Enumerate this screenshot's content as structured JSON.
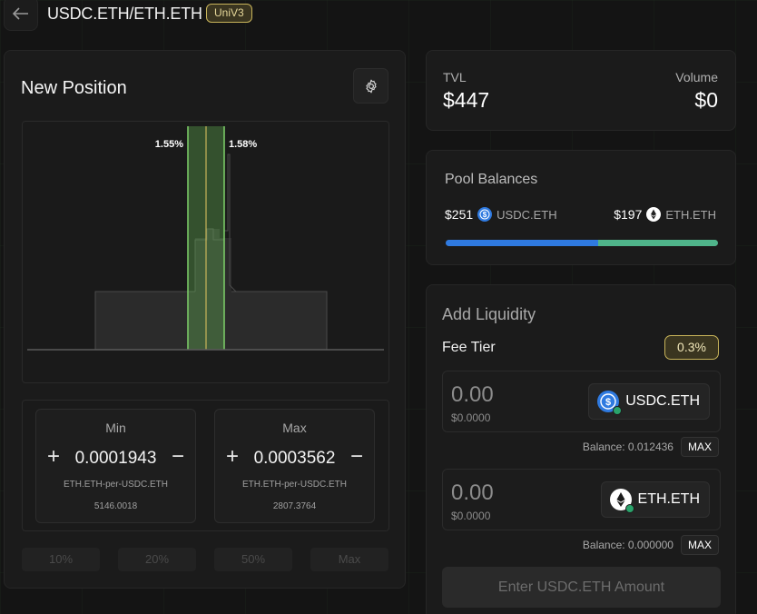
{
  "header": {
    "pair": "USDC.ETH/ETH.ETH",
    "badge": "UniV3"
  },
  "new_position": {
    "title": "New Position",
    "chart_labels": {
      "left_pct": "1.55%",
      "right_pct": "1.58%"
    },
    "min": {
      "label": "Min",
      "value": "0.0001943",
      "unit": "ETH.ETH-per-USDC.ETH",
      "sub": "5146.0018",
      "plus": "+",
      "minus": "−"
    },
    "max": {
      "label": "Max",
      "value": "0.0003562",
      "unit": "ETH.ETH-per-USDC.ETH",
      "sub": "2807.3764",
      "plus": "+",
      "minus": "−"
    },
    "presets": [
      "10%",
      "20%",
      "50%",
      "Max"
    ]
  },
  "stats": {
    "tvl_label": "TVL",
    "tvl_value": "$447",
    "volume_label": "Volume",
    "volume_value": "$0"
  },
  "pool_balances": {
    "title": "Pool Balances",
    "left_amount": "$251",
    "left_token": "USDC.ETH",
    "right_amount": "$197",
    "right_token": "ETH.ETH",
    "left_share": 0.56
  },
  "add_liquidity": {
    "title": "Add Liquidity",
    "fee_label": "Fee Tier",
    "fee_value": "0.3%",
    "input_a": {
      "amount": "0.00",
      "usd": "$0.0000",
      "token": "USDC.ETH",
      "balance": "Balance: 0.012436",
      "max": "MAX"
    },
    "input_b": {
      "amount": "0.00",
      "usd": "$0.0000",
      "token": "ETH.ETH",
      "balance": "Balance: 0.000000",
      "max": "MAX"
    },
    "submit": "Enter USDC.ETH Amount"
  },
  "colors": {
    "usdc": "#2f7ae0",
    "eth": "#4fb48a",
    "range_highlight": "#7fd26a",
    "current_price": "#c8b45a"
  },
  "icons": {
    "back": "arrow-left-icon",
    "settings": "gear-icon",
    "usdc": "usdc-coin-icon",
    "eth": "eth-coin-icon"
  }
}
